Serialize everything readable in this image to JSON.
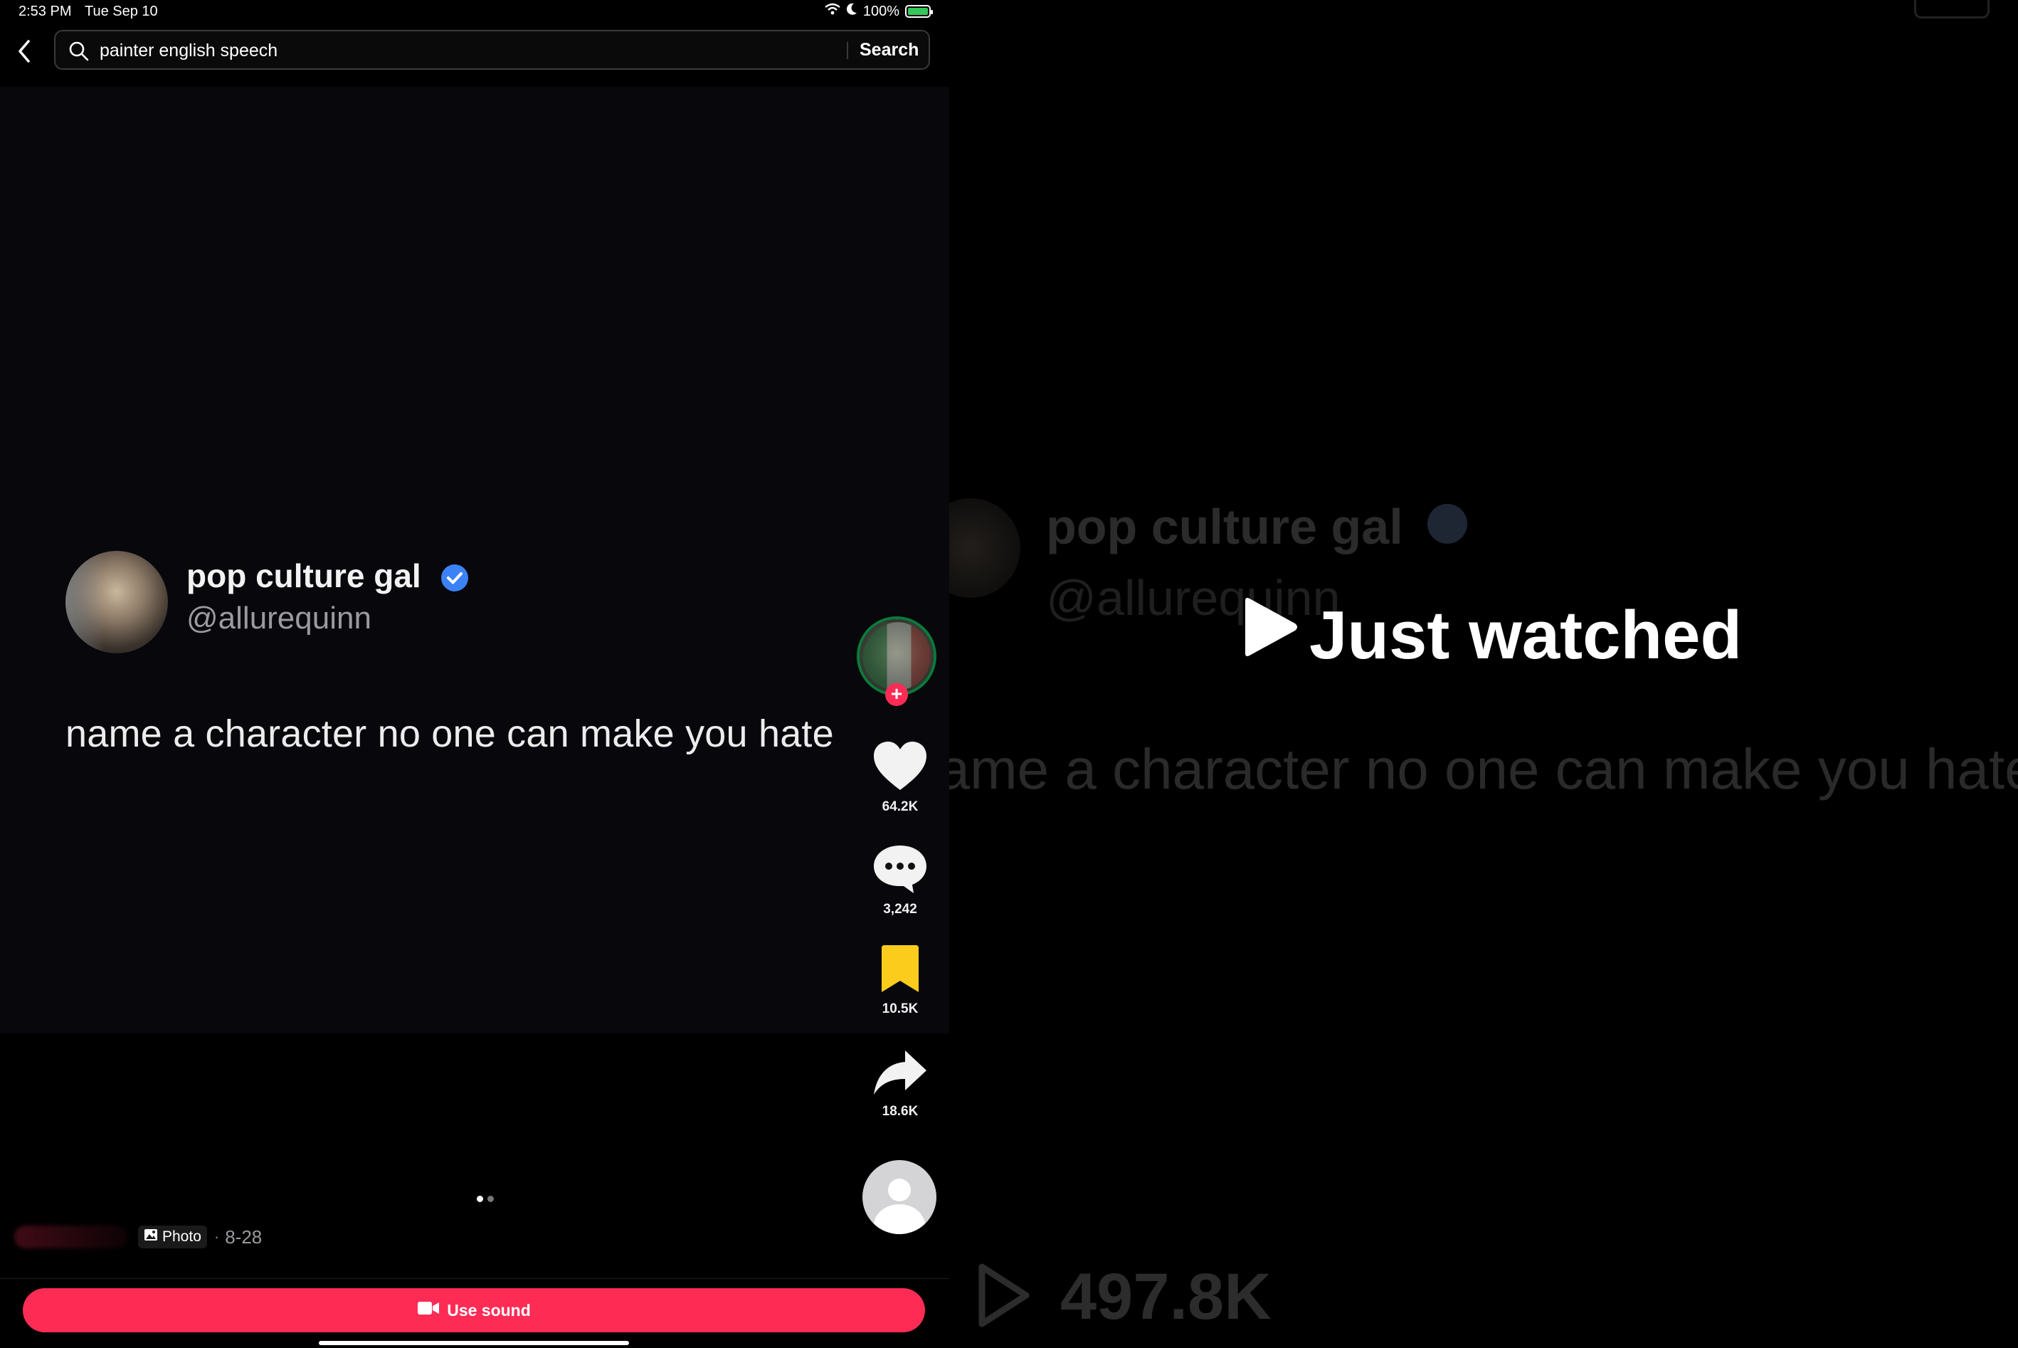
{
  "status_bar": {
    "time": "2:53 PM",
    "date": "Tue Sep 10",
    "battery": "100%"
  },
  "search": {
    "query": "painter english speech",
    "button_label": "Search"
  },
  "post": {
    "display_name": "pop culture gal",
    "handle": "@allurequinn",
    "text": "name a character no one can make you hate"
  },
  "actions": {
    "likes": "64.2K",
    "comments": "3,242",
    "bookmarks": "10.5K",
    "shares": "18.6K"
  },
  "meta": {
    "type_label": "Photo",
    "separator": "·",
    "date": "8-28"
  },
  "bottom": {
    "use_sound_label": "Use sound"
  },
  "overlay": {
    "label": "Just watched",
    "views": "497.8K"
  },
  "colors": {
    "accent": "#fe2c55",
    "bookmark_active": "#fccc1c",
    "verified": "#3b82f6"
  },
  "icons": [
    "back-icon",
    "search-icon",
    "wifi-icon",
    "moon-icon",
    "battery-icon",
    "verified-icon",
    "heart-icon",
    "comment-icon",
    "bookmark-icon",
    "share-icon",
    "photo-icon",
    "video-camera-icon",
    "play-icon"
  ]
}
